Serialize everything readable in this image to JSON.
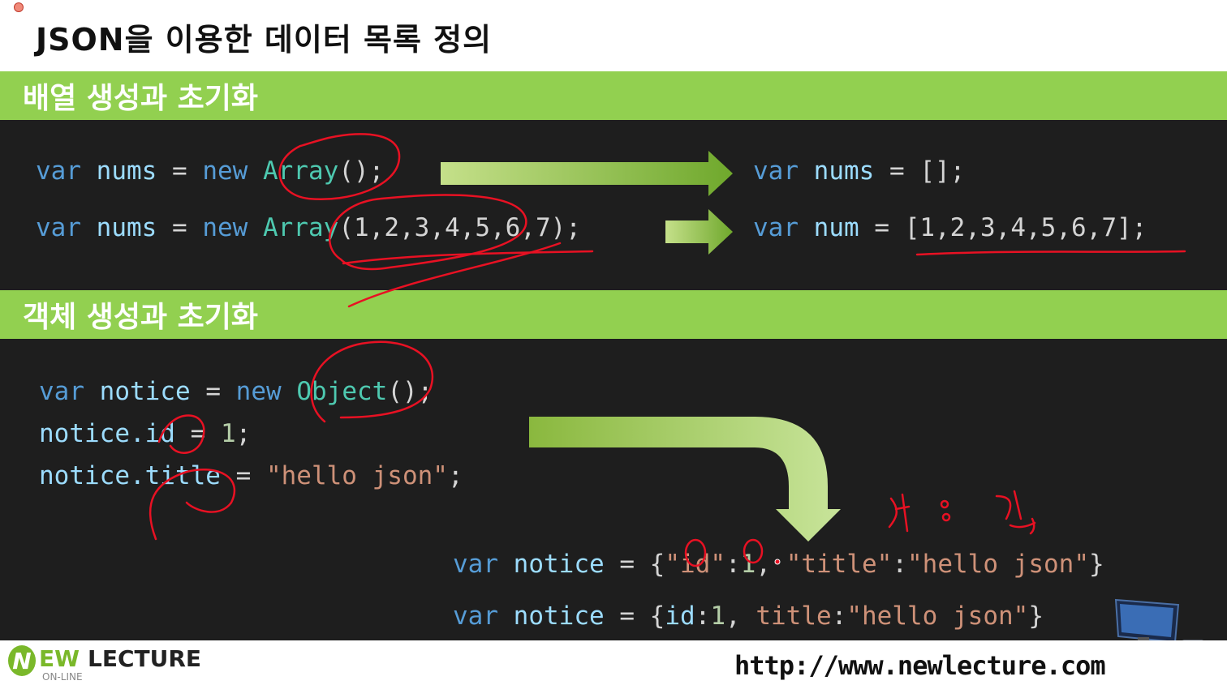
{
  "page_title": "JSON을 이용한 데이터 목록 정의",
  "sections": {
    "array": {
      "header": "배열 생성과 초기화"
    },
    "object": {
      "header": "객체 생성과 초기화"
    }
  },
  "code": {
    "arr1": {
      "kw1": "var",
      "name": "nums",
      "eq": "=",
      "kw2": "new",
      "cls": "Array",
      "rest": "();"
    },
    "arr1r": {
      "kw1": "var",
      "name": "nums",
      "eq": "=",
      "rest": "[];"
    },
    "arr2": {
      "kw1": "var",
      "name": "nums",
      "eq": "=",
      "kw2": "new",
      "cls": "Array",
      "rest": "(1,2,3,4,5,6,7);"
    },
    "arr2r": {
      "kw1": "var",
      "name": "num",
      "eq": "=",
      "rest": "[1,2,3,4,5,6,7];"
    },
    "obj1": {
      "kw1": "var",
      "name": "notice",
      "eq": "=",
      "kw2": "new",
      "cls": "Object",
      "rest": "();"
    },
    "obj2": {
      "lhs": "notice.id",
      "eq": "=",
      "num": "1",
      "end": ";"
    },
    "obj3": {
      "lhs": "notice.title",
      "eq": "=",
      "str": "\"hello json\"",
      "end": ";"
    },
    "objr1": {
      "kw1": "var",
      "name": "notice",
      "eq": "=",
      "open": "{",
      "k1": "\"id\"",
      "colon1": ":",
      "v1": "1",
      "comma": ",",
      "k2": "\"title\"",
      "colon2": ":",
      "v2": "\"hello json\"",
      "close": "}"
    },
    "objr2": {
      "kw1": "var",
      "name": "notice",
      "eq": "=",
      "open": "{",
      "k1": "id",
      "colon1": ":",
      "v1": "1",
      "comma": ",",
      "k2": "title",
      "colon2": ":",
      "v2": "\"hello json\"",
      "close": "}"
    }
  },
  "annotation": "키 : 값,",
  "footer": {
    "logo_n": "N",
    "logo_ew": "EW",
    "logo_lecture": "LECTURE",
    "logo_online": "ON-LINE",
    "url": "http://www.newlecture.com"
  },
  "colors": {
    "header_green": "#92d050",
    "arrow_green": "#8bc34a",
    "code_bg": "#1e1e1e",
    "keyword": "#569cd6",
    "string": "#ce9178",
    "class": "#4ec9b0",
    "ink_red": "#e81123"
  },
  "icons": [
    "red-dot-icon",
    "arrow-right-icon",
    "arrow-curve-down-icon",
    "computer-illustration-icon",
    "newlecture-logo-icon"
  ]
}
